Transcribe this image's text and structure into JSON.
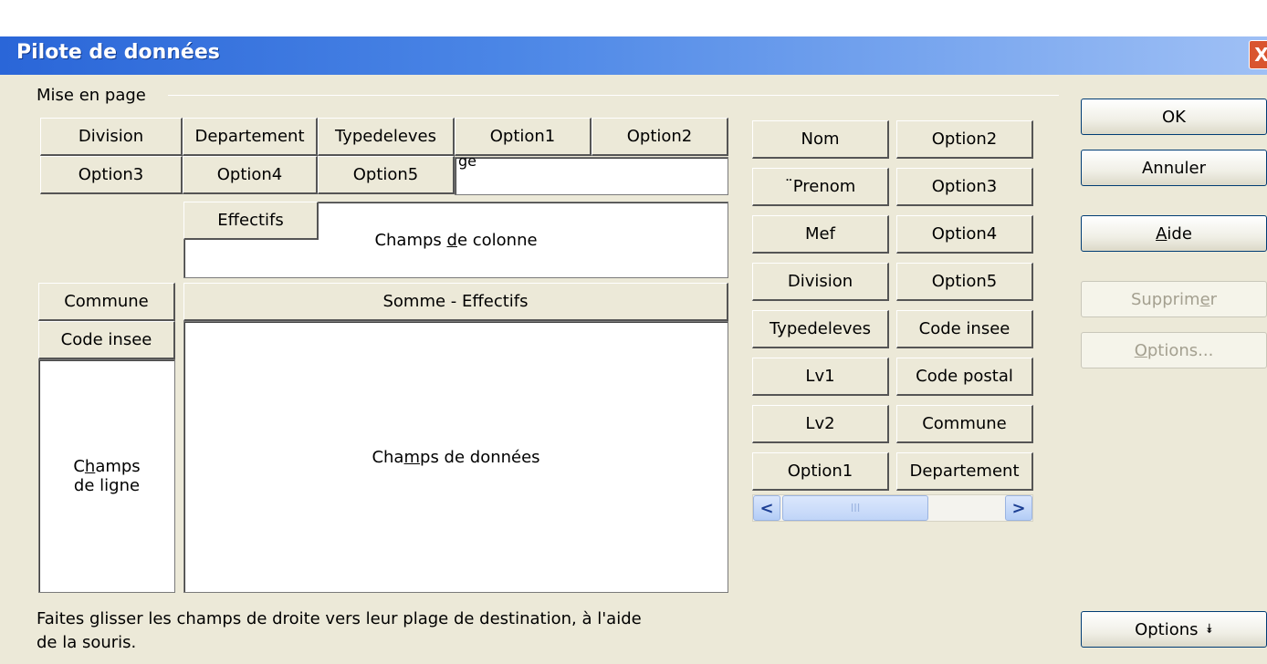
{
  "window": {
    "title": "Pilote de données",
    "close_glyph": "X"
  },
  "layout_group": {
    "label": "Mise en page"
  },
  "page_fields": [
    "Division",
    "Departement",
    "Typedeleves",
    "Option1",
    "Option2",
    "Option3",
    "Option4",
    "Option5"
  ],
  "page_zone_clipped_text": "ge",
  "column_fields": [
    "Effectifs"
  ],
  "column_zone": {
    "label_pre": "Champs ",
    "label_accel": "d",
    "label_post": "e colonne"
  },
  "row_fields": [
    "Commune",
    "Code insee"
  ],
  "row_zone": {
    "label_line1_pre": "C",
    "label_line1_accel": "h",
    "label_line1_post": "amps",
    "label_line2": "de ligne"
  },
  "data_fields": [
    "Somme - Effectifs"
  ],
  "data_zone": {
    "label_pre": "Cha",
    "label_accel": "m",
    "label_post": "ps de données"
  },
  "available_fields_col1": [
    "Nom",
    "¨Prenom",
    "Mef",
    "Division",
    "Typedeleves",
    "Lv1",
    "Lv2",
    "Option1"
  ],
  "available_fields_col2": [
    "Option2",
    "Option3",
    "Option4",
    "Option5",
    "Code insee",
    "Code postal",
    "Commune",
    "Departement"
  ],
  "scrollbar": {
    "left_arrow": "<",
    "right_arrow": ">",
    "grip": "III"
  },
  "buttons": {
    "ok": "OK",
    "cancel": "Annuler",
    "help_accel": "A",
    "help_rest": "ide",
    "delete_pre": "Supprim",
    "delete_accel": "e",
    "delete_post": "r",
    "options_accel": "O",
    "options_rest": "ptions...",
    "more_options": "Options",
    "more_options_glyph": "⯯"
  },
  "hint_text_line1": "Faites glisser les champs de droite vers leur plage de destination, à l'aide",
  "hint_text_line2": "de la souris."
}
